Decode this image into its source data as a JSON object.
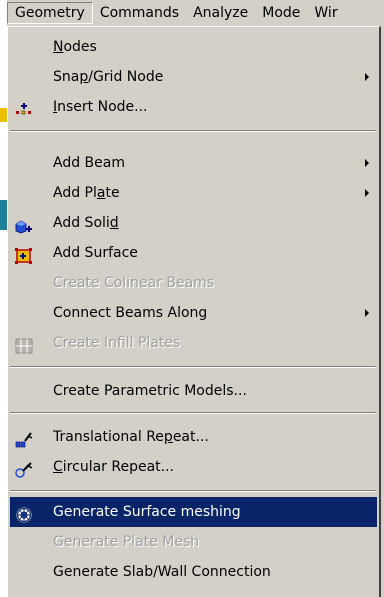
{
  "menubar": {
    "items": [
      "Geometry",
      "Commands",
      "Analyze",
      "Mode",
      "Wir"
    ]
  },
  "menu": {
    "items": [
      {
        "pre": "",
        "key": "N",
        "post": "odes",
        "icon": "",
        "submenu": false,
        "enabled": true
      },
      {
        "pre": "Sna",
        "key": "p",
        "post": "/Grid Node",
        "icon": "",
        "submenu": true,
        "enabled": true
      },
      {
        "pre": "",
        "key": "I",
        "post": "nsert Node...",
        "icon": "insert-node-icon",
        "submenu": false,
        "enabled": true
      },
      {
        "pre": "Add Beam",
        "key": "",
        "post": "",
        "icon": "",
        "submenu": true,
        "enabled": true
      },
      {
        "pre": "Add Pl",
        "key": "a",
        "post": "te",
        "icon": "",
        "submenu": true,
        "enabled": true
      },
      {
        "pre": "Add Soli",
        "key": "d",
        "post": "",
        "icon": "add-solid-icon",
        "submenu": false,
        "enabled": true
      },
      {
        "pre": "Add Surface",
        "key": "",
        "post": "",
        "icon": "add-surface-icon",
        "submenu": false,
        "enabled": true
      },
      {
        "pre": "Create Colinear Beams",
        "key": "",
        "post": "",
        "icon": "",
        "submenu": false,
        "enabled": false
      },
      {
        "pre": "Connect Beams Along",
        "key": "",
        "post": "",
        "icon": "",
        "submenu": true,
        "enabled": true
      },
      {
        "pre": "Create Infill Plates",
        "key": "",
        "post": "",
        "icon": "infill-plates-icon",
        "submenu": false,
        "enabled": false
      },
      {
        "pre": "Create Parametric Models...",
        "key": "",
        "post": "",
        "icon": "",
        "submenu": false,
        "enabled": true
      },
      {
        "pre": "Translational Re",
        "key": "p",
        "post": "eat...",
        "icon": "translational-repeat-icon",
        "submenu": false,
        "enabled": true
      },
      {
        "pre": "",
        "key": "C",
        "post": "ircular Repeat...",
        "icon": "circular-repeat-icon",
        "submenu": false,
        "enabled": true
      },
      {
        "pre": "Generate Surface meshing",
        "key": "",
        "post": "",
        "icon": "surface-meshing-icon",
        "submenu": false,
        "enabled": true
      },
      {
        "pre": "Generate Plate Mesh",
        "key": "",
        "post": "",
        "icon": "",
        "submenu": false,
        "enabled": false
      },
      {
        "pre": "Generate Slab/Wall Connection",
        "key": "",
        "post": "",
        "icon": "",
        "submenu": false,
        "enabled": true
      }
    ]
  },
  "colors": {
    "menu_bg": "#d4d0c8",
    "highlight": "#0a246a",
    "highlight_text": "#ffffff",
    "disabled_text": "#a0a0a0"
  }
}
